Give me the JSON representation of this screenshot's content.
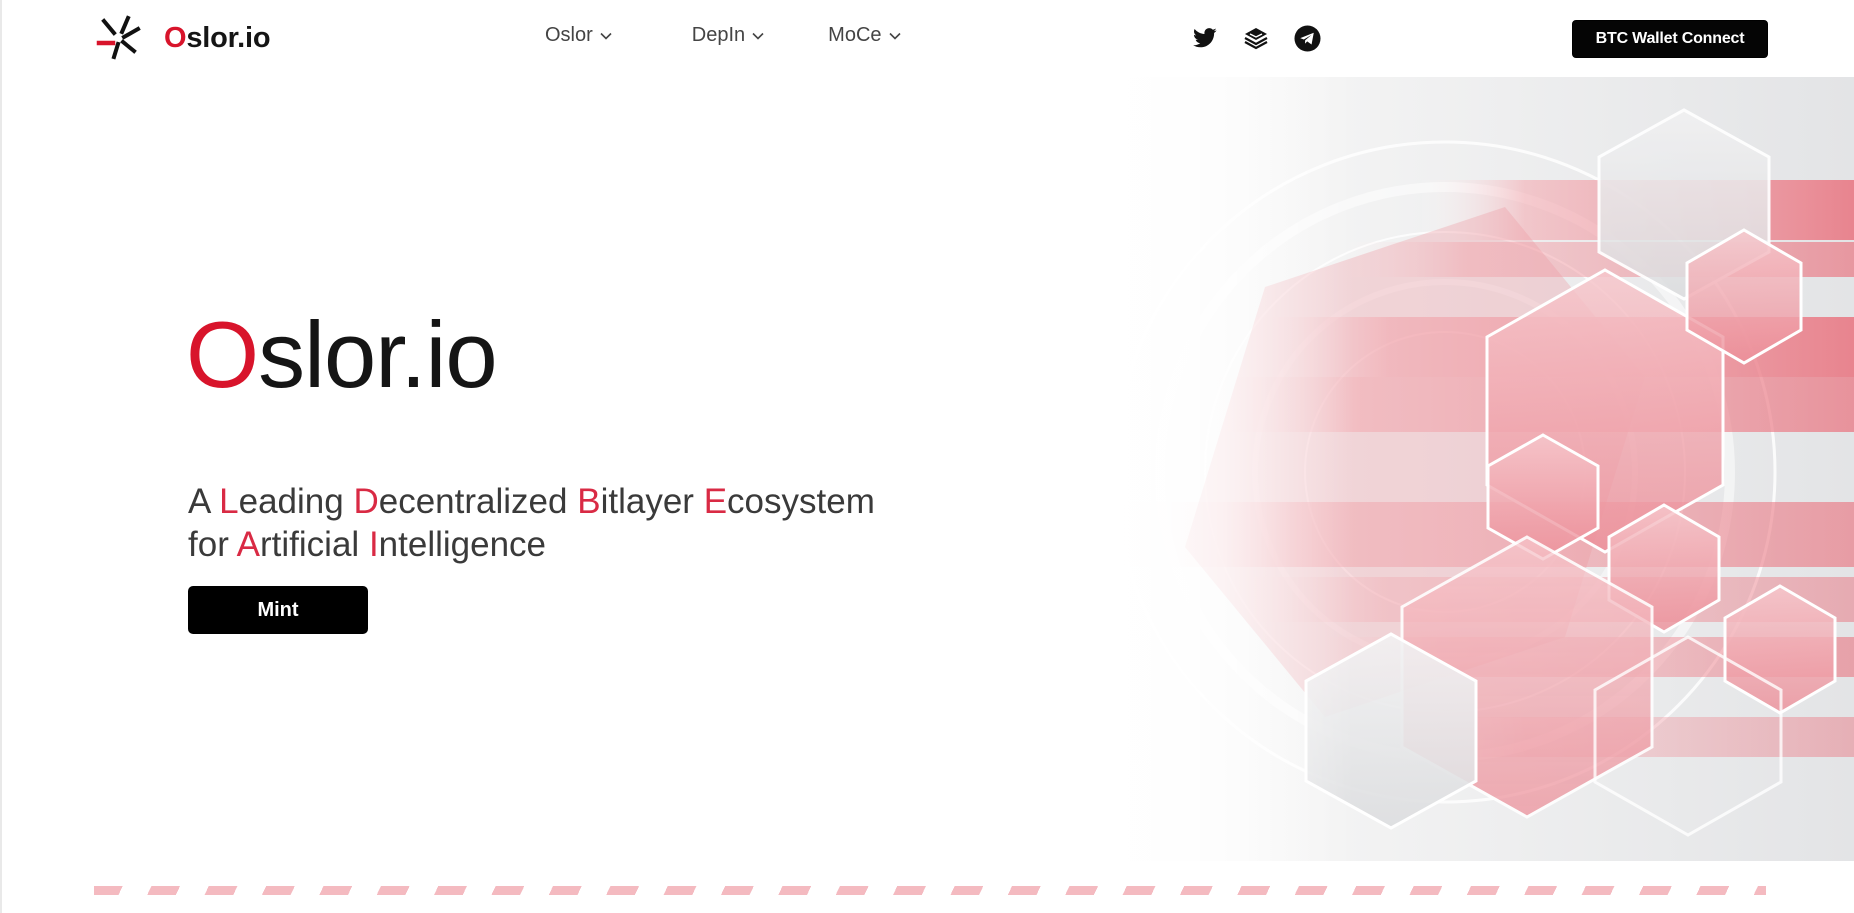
{
  "brand": {
    "first_letter": "O",
    "rest": "slor.io",
    "logo_icon": "oslor-pinwheel-icon"
  },
  "nav": {
    "items": [
      {
        "label": "Oslor"
      },
      {
        "label": "DepIn"
      },
      {
        "label": "MoCe"
      }
    ]
  },
  "social": [
    "twitter-icon",
    "gitbook-icon",
    "telegram-icon"
  ],
  "wallet_button": "BTC Wallet Connect",
  "hero": {
    "title_first": "O",
    "title_rest": "slor.io",
    "sub": {
      "l1": [
        "A",
        "L",
        "eading",
        "D",
        "ecentralized",
        "B",
        "itlayer",
        "E",
        "cosystem"
      ],
      "l2": [
        "for",
        "A",
        "rtificial",
        "I",
        "ntelligence"
      ]
    },
    "mint_label": "Mint"
  },
  "colors": {
    "accent": "#d8142b",
    "highlight": "#d92a44",
    "button": "#000000"
  }
}
